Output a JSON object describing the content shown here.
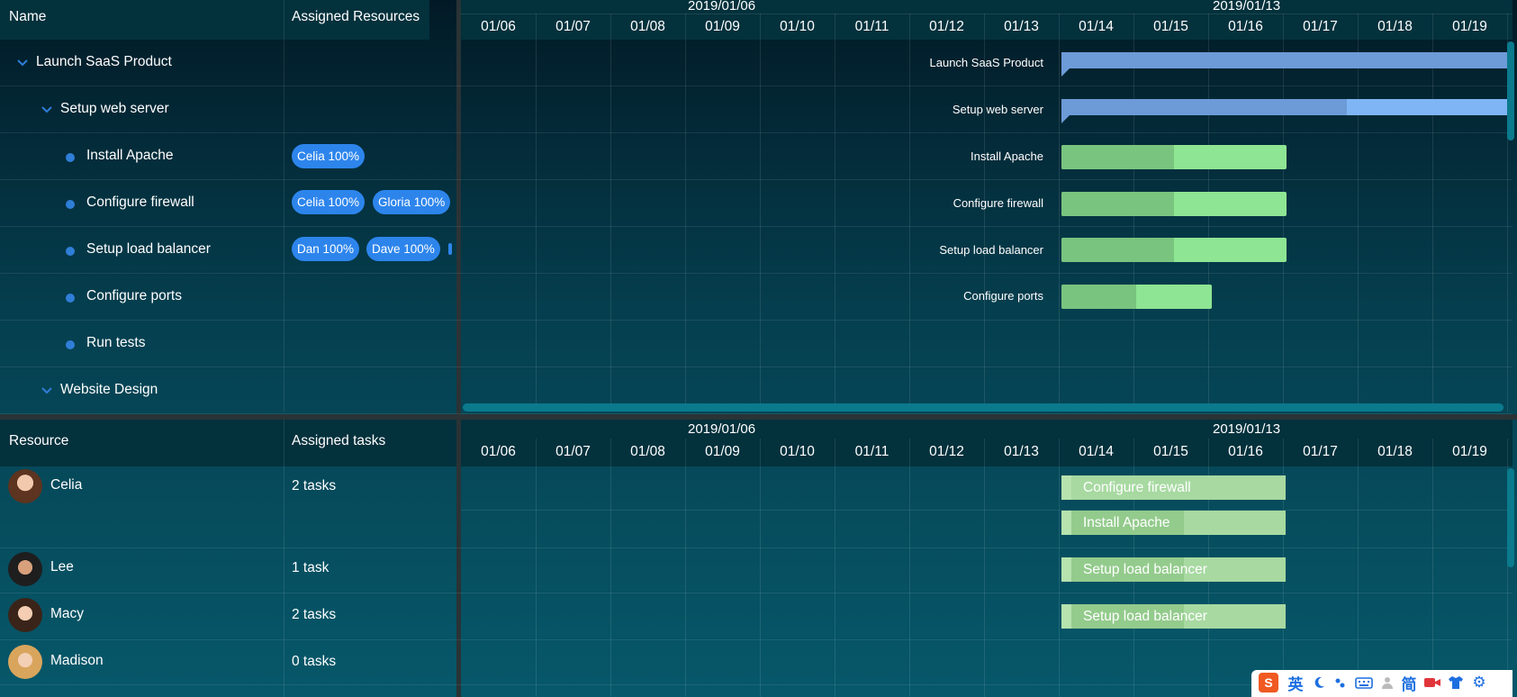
{
  "top": {
    "col_name": "Name",
    "col_resources": "Assigned Resources",
    "week1": "2019/01/06",
    "week2": "2019/01/13",
    "days": [
      "01/06",
      "01/07",
      "01/08",
      "01/09",
      "01/10",
      "01/11",
      "01/12",
      "01/13",
      "01/14",
      "01/15",
      "01/16",
      "01/17",
      "01/18",
      "01/19"
    ],
    "rows": [
      {
        "name": "Launch SaaS Product",
        "type": "parent"
      },
      {
        "name": "Setup web server",
        "type": "parent"
      },
      {
        "name": "Install Apache",
        "type": "leaf"
      },
      {
        "name": "Configure firewall",
        "type": "leaf"
      },
      {
        "name": "Setup load balancer",
        "type": "leaf"
      },
      {
        "name": "Configure ports",
        "type": "leaf"
      },
      {
        "name": "Run tests",
        "type": "leaf"
      },
      {
        "name": "Website Design",
        "type": "parent"
      }
    ],
    "assignments": {
      "install_apache": [
        "Celia 100%"
      ],
      "configure_firewall": [
        "Celia 100%",
        "Gloria 100%"
      ],
      "setup_load_balancer": [
        "Dan 100%",
        "Dave 100%"
      ]
    },
    "bar_labels": [
      "Launch SaaS Product",
      "Setup web server",
      "Install Apache",
      "Configure firewall",
      "Setup load balancer",
      "Configure ports"
    ]
  },
  "bottom": {
    "col_resource": "Resource",
    "col_tasks": "Assigned tasks",
    "resources": [
      {
        "name": "Celia",
        "tasks": "2 tasks"
      },
      {
        "name": "Lee",
        "tasks": "1 task"
      },
      {
        "name": "Macy",
        "tasks": "2 tasks"
      },
      {
        "name": "Madison",
        "tasks": "0 tasks"
      }
    ],
    "task_bars": [
      "Configure firewall",
      "Install Apache",
      "Setup load balancer",
      "Setup load balancer"
    ]
  },
  "tray": {
    "lang": "英",
    "simplified": "简"
  },
  "colors": {
    "summary_bar": "#6d9bd8",
    "summary_bar_light": "#7fb5f5",
    "task_bar_done": "#79c47f",
    "task_bar": "#8ee593",
    "pill": "#2d85ec",
    "resource_bar": "#a7d9a1",
    "scrollbar": "#0b7a8d"
  },
  "icons": [
    "chevron-down-icon",
    "bullet-dot-icon",
    "avatar-icon",
    "sogou-logo-icon",
    "moon-icon",
    "keyboard-icon",
    "user-icon",
    "video-icon",
    "shirt-icon",
    "gear-icon"
  ]
}
